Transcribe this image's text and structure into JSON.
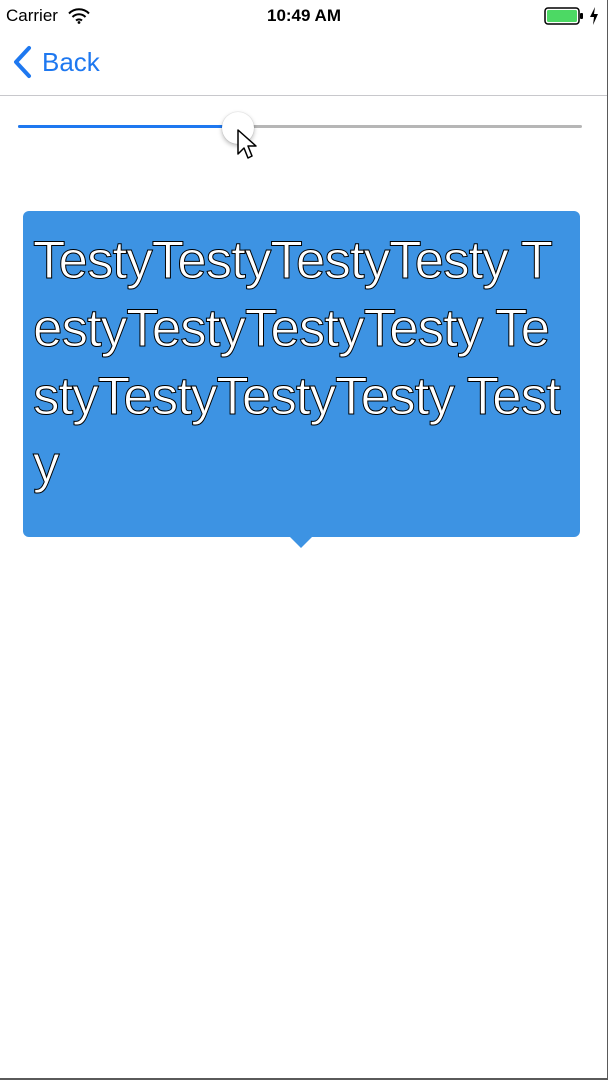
{
  "status_bar": {
    "carrier": "Carrier",
    "time": "10:49 AM",
    "wifi_icon": "wifi-icon",
    "battery_icon": "battery-icon",
    "charging_icon": "charging-bolt-icon",
    "battery_color": "#4cd964"
  },
  "nav": {
    "back_label": "Back",
    "back_icon": "chevron-left-icon",
    "tint_color": "#1e78f0"
  },
  "slider": {
    "value_fraction": 0.39,
    "min_track_color": "#1e78f0",
    "max_track_color": "#b6b6b6"
  },
  "tooltip": {
    "text": "TestyTestyTestyTesty TestyTestyTestyTesty TestyTestyTestyTesty Testy",
    "background_color": "#3d93e3"
  },
  "cursor_icon": "mouse-pointer-icon"
}
